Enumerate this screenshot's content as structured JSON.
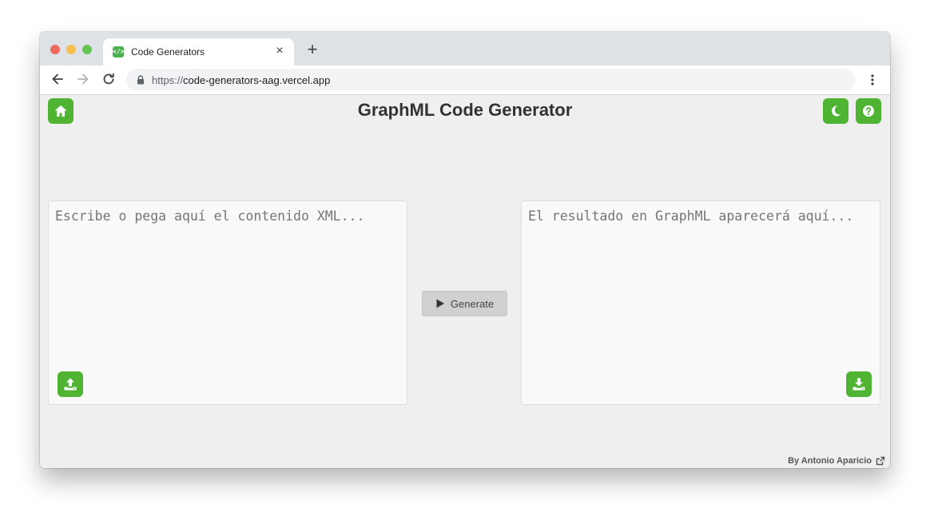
{
  "browser": {
    "tab_title": "Code Generators",
    "favicon_text": "</>",
    "tab_close": "×",
    "new_tab": "+",
    "url_scheme": "https://",
    "url_host": "code-generators-aag.vercel.app"
  },
  "page": {
    "title": "GraphML Code Generator",
    "input_placeholder": "Escribe o pega aquí el contenido XML...",
    "output_placeholder": "El resultado en GraphML aparecerá aquí...",
    "input_value": "",
    "output_value": "",
    "generate_label": "Generate",
    "footer_text": "By Antonio Aparicio"
  },
  "icons": {
    "home": "home-icon",
    "theme": "moon-icon",
    "help": "question-icon",
    "upload": "upload-icon",
    "download": "download-icon",
    "generate": "play-icon",
    "external": "external-link-icon"
  },
  "colors": {
    "accent": "#4fb431",
    "page_background": "#efefef",
    "panel_background": "#f9f9f9"
  }
}
